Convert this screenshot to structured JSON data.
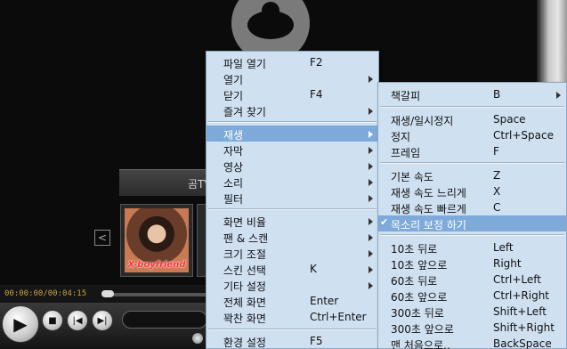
{
  "player": {
    "thumbnail_strip_title": "곰TV",
    "thumbnail_caption": "X-boyfriend",
    "time_readout": "00:00:00/00:04:15",
    "prev_glyph": "<"
  },
  "main_menu": {
    "items": [
      {
        "label": "파일 열기",
        "shortcut": "F2",
        "submenu": false
      },
      {
        "label": "열기",
        "shortcut": "",
        "submenu": true
      },
      {
        "label": "닫기",
        "shortcut": "F4",
        "submenu": false
      },
      {
        "label": "즐겨 찾기",
        "shortcut": "",
        "submenu": true
      },
      {
        "label": "재생",
        "shortcut": "",
        "submenu": true
      },
      {
        "label": "자막",
        "shortcut": "",
        "submenu": true
      },
      {
        "label": "영상",
        "shortcut": "",
        "submenu": true
      },
      {
        "label": "소리",
        "shortcut": "",
        "submenu": true
      },
      {
        "label": "필터",
        "shortcut": "",
        "submenu": true
      },
      {
        "label": "화면 비율",
        "shortcut": "",
        "submenu": true
      },
      {
        "label": "팬 & 스캔",
        "shortcut": "",
        "submenu": true
      },
      {
        "label": "크기 조절",
        "shortcut": "",
        "submenu": true
      },
      {
        "label": "스킨 선택",
        "shortcut": "K",
        "submenu": true
      },
      {
        "label": "기타 설정",
        "shortcut": "",
        "submenu": true
      },
      {
        "label": "전체 화면",
        "shortcut": "Enter",
        "submenu": false
      },
      {
        "label": "꽉찬 화면",
        "shortcut": "Ctrl+Enter",
        "submenu": false
      },
      {
        "label": "환경 설정",
        "shortcut": "F5",
        "submenu": false
      }
    ],
    "highlighted": "재생"
  },
  "playback_submenu": {
    "items": [
      {
        "label": "책갈피",
        "shortcut": "B",
        "submenu": true,
        "checked": false,
        "disabled": false
      },
      {
        "label": "재생/일시정지",
        "shortcut": "Space",
        "submenu": false,
        "checked": false,
        "disabled": false
      },
      {
        "label": "정지",
        "shortcut": "Ctrl+Space",
        "submenu": false,
        "checked": false,
        "disabled": false
      },
      {
        "label": "프레임",
        "shortcut": "F",
        "submenu": false,
        "checked": false,
        "disabled": false
      },
      {
        "label": "기본 속도",
        "shortcut": "Z",
        "submenu": false,
        "checked": false,
        "disabled": false
      },
      {
        "label": "재생 속도 느리게",
        "shortcut": "X",
        "submenu": false,
        "checked": false,
        "disabled": false
      },
      {
        "label": "재생 속도 빠르게",
        "shortcut": "C",
        "submenu": false,
        "checked": false,
        "disabled": false
      },
      {
        "label": "목소리 보정 하기",
        "shortcut": "",
        "submenu": false,
        "checked": true,
        "disabled": false
      },
      {
        "label": "10초 뒤로",
        "shortcut": "Left",
        "submenu": false,
        "checked": false,
        "disabled": false
      },
      {
        "label": "10초 앞으로",
        "shortcut": "Right",
        "submenu": false,
        "checked": false,
        "disabled": false
      },
      {
        "label": "60초 뒤로",
        "shortcut": "Ctrl+Left",
        "submenu": false,
        "checked": false,
        "disabled": false
      },
      {
        "label": "60초 앞으로",
        "shortcut": "Ctrl+Right",
        "submenu": false,
        "checked": false,
        "disabled": false
      },
      {
        "label": "300초 뒤로",
        "shortcut": "Shift+Left",
        "submenu": false,
        "checked": false,
        "disabled": false
      },
      {
        "label": "300초 앞으로",
        "shortcut": "Shift+Right",
        "submenu": false,
        "checked": false,
        "disabled": false
      },
      {
        "label": "맨 처음으로..",
        "shortcut": "BackSpace",
        "submenu": false,
        "checked": false,
        "disabled": false
      }
    ],
    "highlighted": "목소리 보정 하기",
    "check_glyph": "✔"
  },
  "colors": {
    "menu_bg": "#cfe0f1",
    "menu_highlight": "#7eaad9",
    "time_text": "#c8a040"
  }
}
